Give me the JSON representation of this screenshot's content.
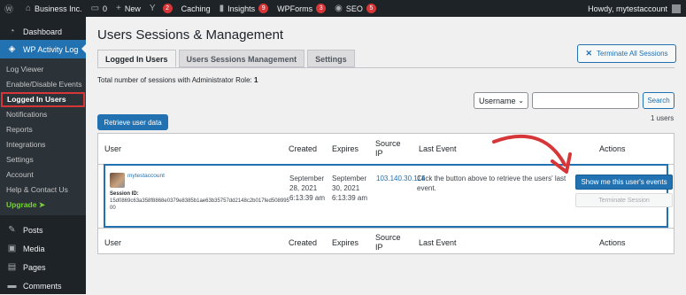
{
  "adminbar": {
    "site_name": "Business Inc.",
    "comments_count": "0",
    "new_label": "New",
    "yoast_count": "2",
    "caching_label": "Caching",
    "insights_label": "Insights",
    "insights_count": "9",
    "wpforms_label": "WPForms",
    "wpforms_count": "3",
    "seo_label": "SEO",
    "seo_count": "5",
    "howdy": "Howdy, mytestaccount"
  },
  "sidebar": {
    "dashboard": "Dashboard",
    "plugin": "WP Activity Log",
    "sub_items": [
      "Log Viewer",
      "Enable/Disable Events",
      "Logged In Users",
      "Notifications",
      "Reports",
      "Integrations",
      "Settings",
      "Account",
      "Help & Contact Us",
      "Upgrade ➤"
    ],
    "posts": "Posts",
    "media": "Media",
    "pages": "Pages",
    "comments": "Comments"
  },
  "page": {
    "title": "Users Sessions & Management",
    "terminate_all": "Terminate All Sessions",
    "tabs": [
      "Logged In Users",
      "Users Sessions Management",
      "Settings"
    ],
    "total_label": "Total number of sessions with Administrator Role:",
    "total_value": "1",
    "search_select": "Username",
    "search_input": "",
    "search_button": "Search",
    "retrieve_button": "Retrieve user data",
    "users_count": "1 users"
  },
  "table": {
    "headers": {
      "user": "User",
      "created": "Created",
      "expires": "Expires",
      "source_ip": "Source IP",
      "last_event": "Last Event",
      "actions": "Actions"
    },
    "row": {
      "username": "mytestaccount",
      "session_id_label": "Session ID:",
      "session_id": "15d0869c63a358f8868e0379e8385b1ae63b35757dd2148c2b017fed50899500",
      "created": "September 28, 2021 6:13:39 am",
      "expires": "September 30, 2021 6:13:39 am",
      "source_ip": "103.140.30.114",
      "last_event": "Click the button above to retrieve the users' last event.",
      "show_events_button": "Show me this user's events",
      "terminate_button": "Terminate Session"
    }
  },
  "colors": {
    "admin_bar": "#1d2327",
    "accent": "#2271b1",
    "highlight": "#d63638"
  }
}
